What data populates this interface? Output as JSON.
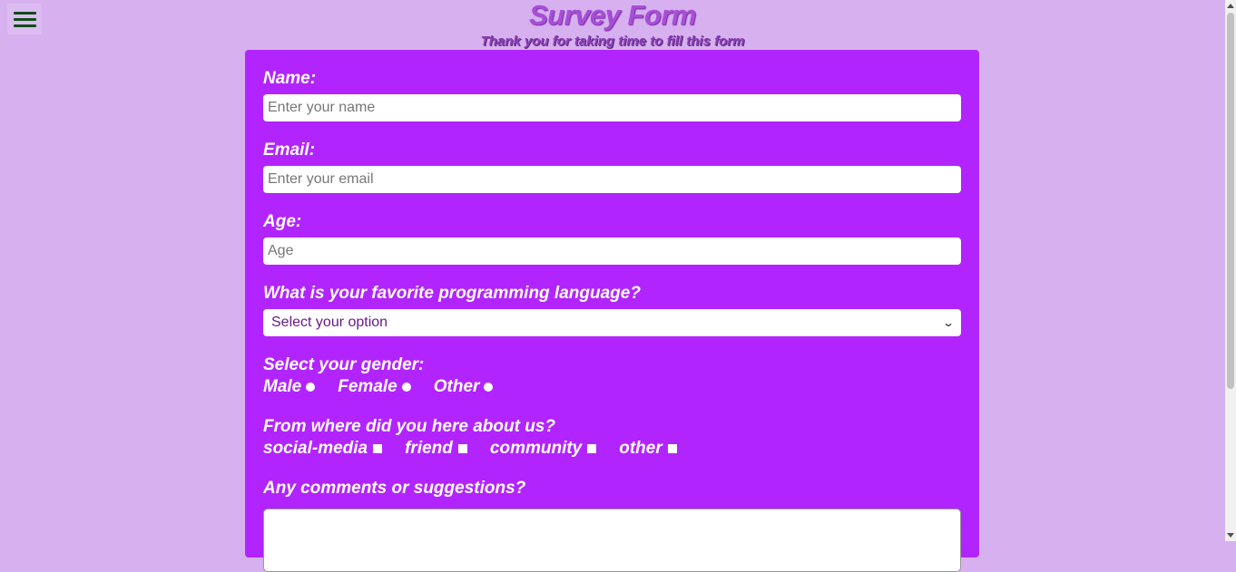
{
  "header": {
    "title": "Survey Form",
    "subtitle": "Thank you for taking time to fill this form"
  },
  "menu": {
    "icon": "hamburger-menu-icon"
  },
  "form": {
    "name_label": "Name:",
    "name_placeholder": "Enter your name",
    "email_label": "Email:",
    "email_placeholder": "Enter your email",
    "age_label": "Age:",
    "age_placeholder": "Age",
    "language_label": "What is your favorite programming language?",
    "language_selected": "Select your option",
    "gender_label": "Select your gender:",
    "gender_options": [
      "Male",
      "Female",
      "Other"
    ],
    "source_label": "From where did you here about us?",
    "source_options": [
      "social-media",
      "friend",
      "community",
      "other"
    ],
    "comments_label": "Any comments or suggestions?"
  },
  "colors": {
    "page_bg": "#d7b1ef",
    "form_bg": "#b224fd",
    "title": "#a64fd6",
    "menu_icon": "#0f4d17"
  }
}
